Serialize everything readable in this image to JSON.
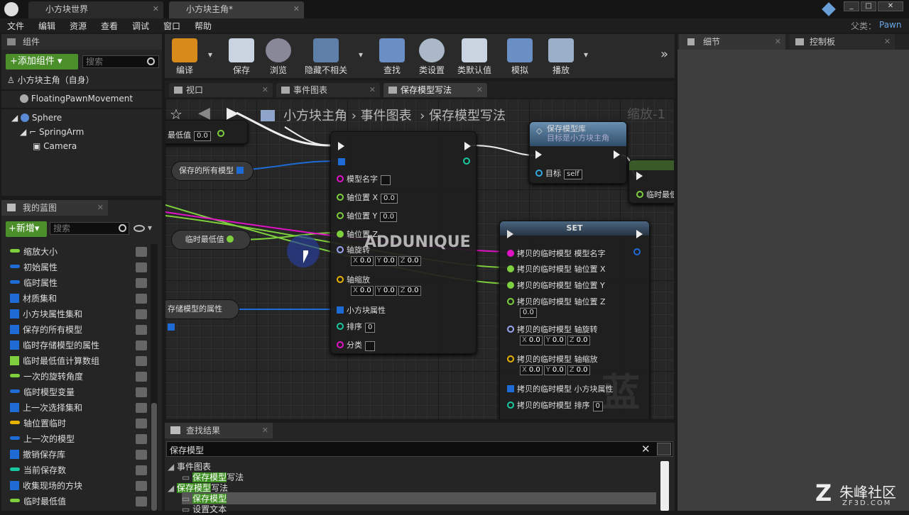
{
  "window": {
    "tabs": [
      "小方块世界",
      "小方块主角*"
    ],
    "parent_label": "父类：",
    "parent_value": "Pawn"
  },
  "menu": [
    "文件",
    "编辑",
    "资源",
    "查看",
    "调试",
    "窗口",
    "帮助"
  ],
  "components": {
    "title": "组件",
    "add_button": "添加组件",
    "search_placeholder": "搜索",
    "self_label": "小方块主角（自身）",
    "items": [
      "FloatingPawnMovement",
      "Sphere",
      "SpringArm",
      "Camera"
    ]
  },
  "toolbar": [
    "编译",
    "保存",
    "浏览",
    "隐藏不相关",
    "查找",
    "类设置",
    "类默认值",
    "模拟",
    "播放"
  ],
  "doc_tabs": [
    "视口",
    "事件图表",
    "保存模型写法"
  ],
  "breadcrumb": {
    "root": "小方块主角",
    "mid": "事件图表",
    "leaf": "保存模型写法",
    "zoom": "缩放-1"
  },
  "my_blueprint": {
    "title": "我的蓝图",
    "new_button": "新增",
    "search_placeholder": "搜索",
    "vars": [
      {
        "name": "缩放大小",
        "color": "#7ecf3e",
        "kind": "bar"
      },
      {
        "name": "初始属性",
        "color": "#1f6bd6",
        "kind": "bar"
      },
      {
        "name": "临时属性",
        "color": "#1f6bd6",
        "kind": "bar"
      },
      {
        "name": "材质集和",
        "color": "#1f6bd6",
        "kind": "grid"
      },
      {
        "name": "小方块属性集和",
        "color": "#1f6bd6",
        "kind": "grid"
      },
      {
        "name": "保存的所有模型",
        "color": "#1f6bd6",
        "kind": "grid"
      },
      {
        "name": "临时存储模型的属性",
        "color": "#1f6bd6",
        "kind": "grid"
      },
      {
        "name": "临时最低值计算数组",
        "color": "#7ecf3e",
        "kind": "grid"
      },
      {
        "name": "一次的旋转角度",
        "color": "#7ecf3e",
        "kind": "bar"
      },
      {
        "name": "临时模型变量",
        "color": "#1f6bd6",
        "kind": "bar"
      },
      {
        "name": "上一次选择集和",
        "color": "#1f6bd6",
        "kind": "grid"
      },
      {
        "name": "轴位置临时",
        "color": "#e6b400",
        "kind": "bar"
      },
      {
        "name": "上一次的模型",
        "color": "#1f6bd6",
        "kind": "bar"
      },
      {
        "name": "撤销保存库",
        "color": "#1f6bd6",
        "kind": "grid"
      },
      {
        "name": "当前保存数",
        "color": "#19c7a0",
        "kind": "bar"
      },
      {
        "name": "收集现场的方块",
        "color": "#1f6bd6",
        "kind": "grid"
      },
      {
        "name": "临时最低值",
        "color": "#7ecf3e",
        "kind": "bar"
      }
    ]
  },
  "graph": {
    "var_nodes": [
      "最低值",
      "保存的所有模型",
      "临时最低值",
      "存储模型的属性"
    ],
    "set_label": "SET",
    "min_val": "0.0",
    "make_node": {
      "pins": [
        "模型名字",
        "轴位置 X",
        "轴位置 Y",
        "轴位置 Z",
        "轴旋转",
        "轴缩放",
        "小方块属性",
        "排序",
        "分类"
      ],
      "x": "0.0",
      "y": "0.0",
      "z": "0.0"
    },
    "call_node": {
      "title": "保存模型库",
      "subtitle": "目标是小方块主角",
      "target": "目标",
      "self": "self"
    },
    "right_node": "临时最低",
    "set_node": {
      "title": "SET",
      "pins": [
        "拷贝的临时模型 模型名字",
        "拷贝的临时模型 轴位置 X",
        "拷贝的临时模型 轴位置 Y",
        "拷贝的临时模型 轴位置 Z",
        "拷贝的临时模型 轴旋转",
        "拷贝的临时模型 轴缩放",
        "拷贝的临时模型 小方块属性",
        "拷贝的临时模型 排序"
      ]
    },
    "watermark": "ADDUNIQUE",
    "corner_mark": "蓝图",
    "order_val": "0"
  },
  "details": {
    "tab1": "细节",
    "tab2": "控制板"
  },
  "find": {
    "title": "查找结果",
    "query": "保存模型",
    "results": [
      {
        "hl": "",
        "text": "事件图表",
        "indent": 0
      },
      {
        "hl": "保存模型",
        "text": "写法",
        "indent": 1
      },
      {
        "hl": "保存模型",
        "text": "写法",
        "indent": 0
      },
      {
        "hl": "保存模型",
        "text": "",
        "indent": 1
      },
      {
        "hl": "",
        "text": "设置文本",
        "indent": 1
      }
    ]
  },
  "logo": {
    "name": "朱峰社区",
    "url": "ZF3D.COM"
  }
}
